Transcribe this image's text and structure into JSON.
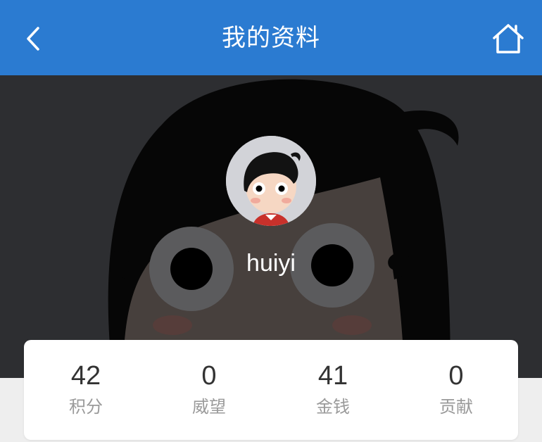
{
  "header": {
    "title": "我的资料",
    "background": "#2b7bd1",
    "back_icon": "chevron-left-icon",
    "home_icon": "home-icon"
  },
  "profile": {
    "username": "huiyi",
    "avatar_icon": "cartoon-avatar"
  },
  "stats": [
    {
      "value": "42",
      "label": "积分"
    },
    {
      "value": "0",
      "label": "威望"
    },
    {
      "value": "41",
      "label": "金钱"
    },
    {
      "value": "0",
      "label": "贡献"
    }
  ]
}
